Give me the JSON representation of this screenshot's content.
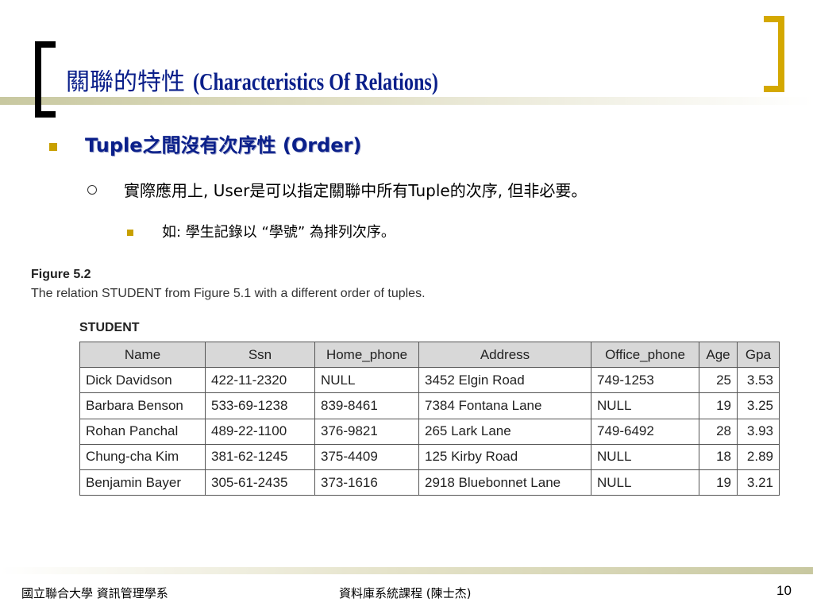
{
  "slide": {
    "title_zh": "關聯的特性 ",
    "title_en": "(Characteristics Of Relations)",
    "bullet_1": "Tuple之間沒有次序性 (Order)",
    "bullet_2": "實際應用上, User是可以指定關聯中所有Tuple的次序, 但非必要。",
    "bullet_3": "如: 學生記錄以 “學號” 為排列次序。"
  },
  "figure": {
    "label": "Figure 5.2",
    "caption": "The relation STUDENT from Figure 5.1 with a different order of tuples.",
    "table_name": "STUDENT",
    "columns": [
      "Name",
      "Ssn",
      "Home_phone",
      "Address",
      "Office_phone",
      "Age",
      "Gpa"
    ],
    "rows": [
      [
        "Dick Davidson",
        "422-11-2320",
        "NULL",
        "3452 Elgin Road",
        "749-1253",
        "25",
        "3.53"
      ],
      [
        "Barbara Benson",
        "533-69-1238",
        "839-8461",
        "7384 Fontana Lane",
        "NULL",
        "19",
        "3.25"
      ],
      [
        "Rohan Panchal",
        "489-22-1100",
        "376-9821",
        "265 Lark Lane",
        "749-6492",
        "28",
        "3.93"
      ],
      [
        "Chung-cha Kim",
        "381-62-1245",
        "375-4409",
        "125 Kirby Road",
        "NULL",
        "18",
        "2.89"
      ],
      [
        "Benjamin Bayer",
        "305-61-2435",
        "373-1616",
        "2918 Bluebonnet Lane",
        "NULL",
        "19",
        "3.21"
      ]
    ]
  },
  "footer": {
    "left": "國立聯合大學 資訊管理學系",
    "center": "資料庫系統課程 (陳士杰)",
    "page_number": "10"
  },
  "colors": {
    "title": "#0a1f8a",
    "bullet": "#c8a000",
    "right_bracket": "#d4a800",
    "header_fill": "#d8d8d8"
  }
}
